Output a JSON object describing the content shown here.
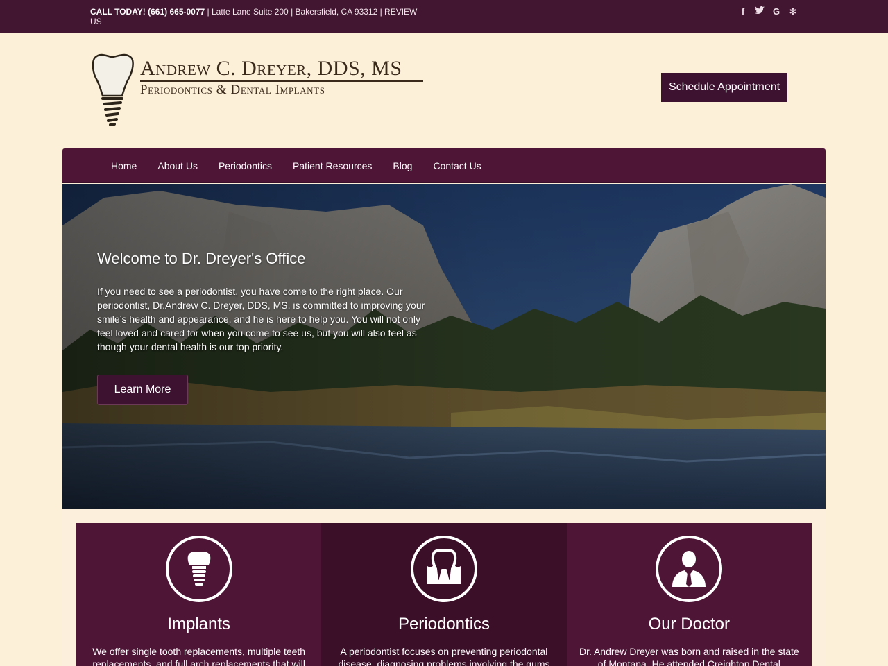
{
  "topbar": {
    "call_label": "CALL TODAY! (661) 665-0077",
    "address": " | Latte Lane Suite 200 | Bakersfield, CA 93312 | REVIEW US",
    "social": [
      {
        "icon": "facebook-icon",
        "glyph": "f"
      },
      {
        "icon": "twitter-icon",
        "glyph": "t"
      },
      {
        "icon": "google-icon",
        "glyph": "G"
      },
      {
        "icon": "yelp-icon",
        "glyph": "✻"
      }
    ]
  },
  "header": {
    "logo_name": "Andrew C. Dreyer, DDS, MS",
    "logo_sub": "Periodontics & Dental Implants",
    "schedule_label": "Schedule Appointment"
  },
  "nav": {
    "items": [
      "Home",
      "About Us",
      "Periodontics",
      "Patient Resources",
      "Blog",
      "Contact Us"
    ]
  },
  "hero": {
    "title": "Welcome to Dr. Dreyer's Office",
    "text": "If you need to see a periodontist, you have come to the right place. Our periodontist, Dr.Andrew C. Dreyer, DDS, MS, is committed to improving your smile’s health and appearance, and he is here to help you. You will not only feel loved and cared for when you come to see us, but you will also feel as though your dental health is our top priority.",
    "button_label": "Learn More"
  },
  "features": [
    {
      "icon": "dental-implant-icon",
      "title": "Implants",
      "text": "We offer single tooth replacements, multiple teeth replacements, and full arch replacements that will"
    },
    {
      "icon": "tooth-gums-icon",
      "title": "Periodontics",
      "text": "A periodontist focuses on preventing periodontal disease, diagnosing problems involving the gums"
    },
    {
      "icon": "doctor-icon",
      "title": "Our Doctor",
      "text": "Dr. Andrew Dreyer was born and raised in the state of Montana. He attended Creighton Dental"
    }
  ],
  "colors": {
    "brand_plum": "#4e1536",
    "dark_plum": "#3c0f29",
    "cream_bg": "#fdf0d8"
  }
}
